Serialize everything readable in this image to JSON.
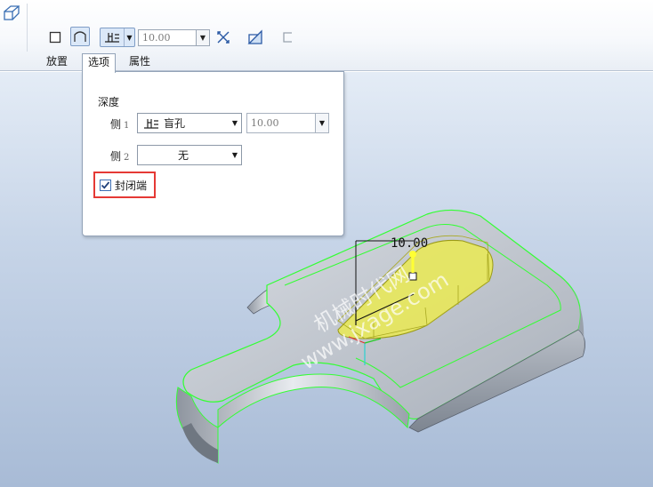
{
  "dashboard": {
    "depth_value": "10.00",
    "tabs": [
      {
        "label": "放置",
        "active": false
      },
      {
        "label": "选项",
        "active": true
      },
      {
        "label": "属性",
        "active": false
      }
    ]
  },
  "options_panel": {
    "depth_title": "深度",
    "side1": {
      "label": "侧",
      "number": "1",
      "option": "盲孔",
      "depth": "10.00"
    },
    "side2": {
      "label": "侧",
      "number": "2",
      "option": "无"
    },
    "capped_ends": {
      "label": "封闭端",
      "checked": true
    }
  },
  "viewport": {
    "dimension_label": "10.00",
    "watermark_line1": "机械时代网",
    "watermark_line2": "www.jxage.com"
  },
  "colors": {
    "highlight_box": "#e53935",
    "accent": "#7f9dc6",
    "feature_yellow": "#e8e85a",
    "edge_green": "#33ff33"
  },
  "icons": [
    "extrude-feature-icon",
    "solid-icon",
    "surface-icon",
    "blind-depth-icon",
    "flip-direction-icon",
    "remove-material-icon",
    "thicken-icon"
  ]
}
